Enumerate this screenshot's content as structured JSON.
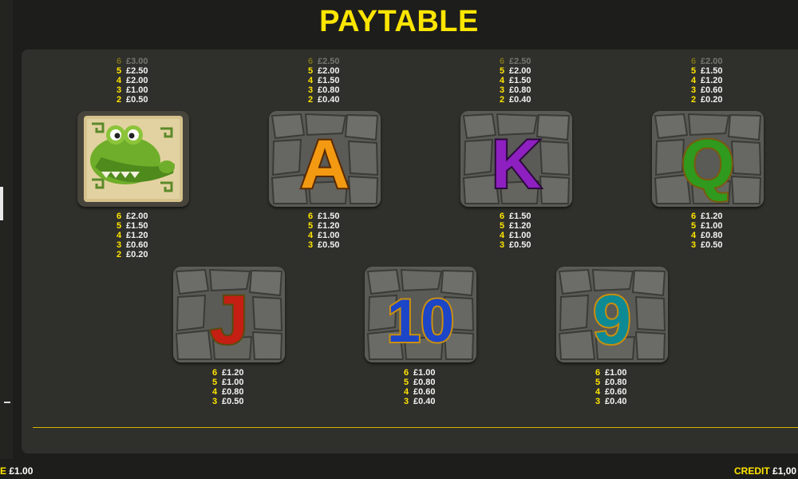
{
  "title": "PAYTABLE",
  "symbols_top": [
    {
      "name": "crocodile",
      "pays_above": [
        [
          "6",
          "£3.00"
        ],
        [
          "5",
          "£2.50"
        ],
        [
          "4",
          "£2.00"
        ],
        [
          "3",
          "£1.00"
        ],
        [
          "2",
          "£0.50"
        ]
      ],
      "pays_below": [
        [
          "6",
          "£2.00"
        ],
        [
          "5",
          "£1.50"
        ],
        [
          "4",
          "£1.20"
        ],
        [
          "3",
          "£0.60"
        ],
        [
          "2",
          "£0.20"
        ]
      ]
    },
    {
      "name": "A",
      "pays_above": [
        [
          "6",
          "£2.50"
        ],
        [
          "5",
          "£2.00"
        ],
        [
          "4",
          "£1.50"
        ],
        [
          "3",
          "£0.80"
        ],
        [
          "2",
          "£0.40"
        ]
      ],
      "pays_below": [
        [
          "6",
          "£1.50"
        ],
        [
          "5",
          "£1.20"
        ],
        [
          "4",
          "£1.00"
        ],
        [
          "3",
          "£0.50"
        ]
      ]
    },
    {
      "name": "K",
      "pays_above": [
        [
          "6",
          "£2.50"
        ],
        [
          "5",
          "£2.00"
        ],
        [
          "4",
          "£1.50"
        ],
        [
          "3",
          "£0.80"
        ],
        [
          "2",
          "£0.40"
        ]
      ],
      "pays_below": [
        [
          "6",
          "£1.50"
        ],
        [
          "5",
          "£1.20"
        ],
        [
          "4",
          "£1.00"
        ],
        [
          "3",
          "£0.50"
        ]
      ]
    },
    {
      "name": "Q",
      "pays_above": [
        [
          "6",
          "£2.00"
        ],
        [
          "5",
          "£1.50"
        ],
        [
          "4",
          "£1.20"
        ],
        [
          "3",
          "£0.60"
        ],
        [
          "2",
          "£0.20"
        ]
      ],
      "pays_below": [
        [
          "6",
          "£1.20"
        ],
        [
          "5",
          "£1.00"
        ],
        [
          "4",
          "£0.80"
        ],
        [
          "3",
          "£0.50"
        ]
      ]
    }
  ],
  "symbols_bottom": [
    {
      "name": "J",
      "pays": [
        [
          "6",
          "£1.20"
        ],
        [
          "5",
          "£1.00"
        ],
        [
          "4",
          "£0.80"
        ],
        [
          "3",
          "£0.50"
        ]
      ]
    },
    {
      "name": "10",
      "pays": [
        [
          "6",
          "£1.00"
        ],
        [
          "5",
          "£0.80"
        ],
        [
          "4",
          "£0.60"
        ],
        [
          "3",
          "£0.40"
        ]
      ]
    },
    {
      "name": "9",
      "pays": [
        [
          "6",
          "£1.00"
        ],
        [
          "5",
          "£0.80"
        ],
        [
          "4",
          "£0.60"
        ],
        [
          "3",
          "£0.40"
        ]
      ]
    }
  ],
  "tile_glyphs": {
    "A": "A",
    "K": "K",
    "Q": "Q",
    "J": "J",
    "ten": "10",
    "nine": "9"
  },
  "colors": {
    "accent": "#ffe500",
    "A": "#f39a12",
    "K": "#8e1fc0",
    "Q": "#2f9a1d",
    "J": "#c41f12",
    "ten": "#1c45c8",
    "nine": "#0e8a94"
  },
  "footer": {
    "bet_label": "E",
    "bet_value": "£1.00",
    "credit_label": "CREDIT",
    "credit_value": "£1,00"
  }
}
